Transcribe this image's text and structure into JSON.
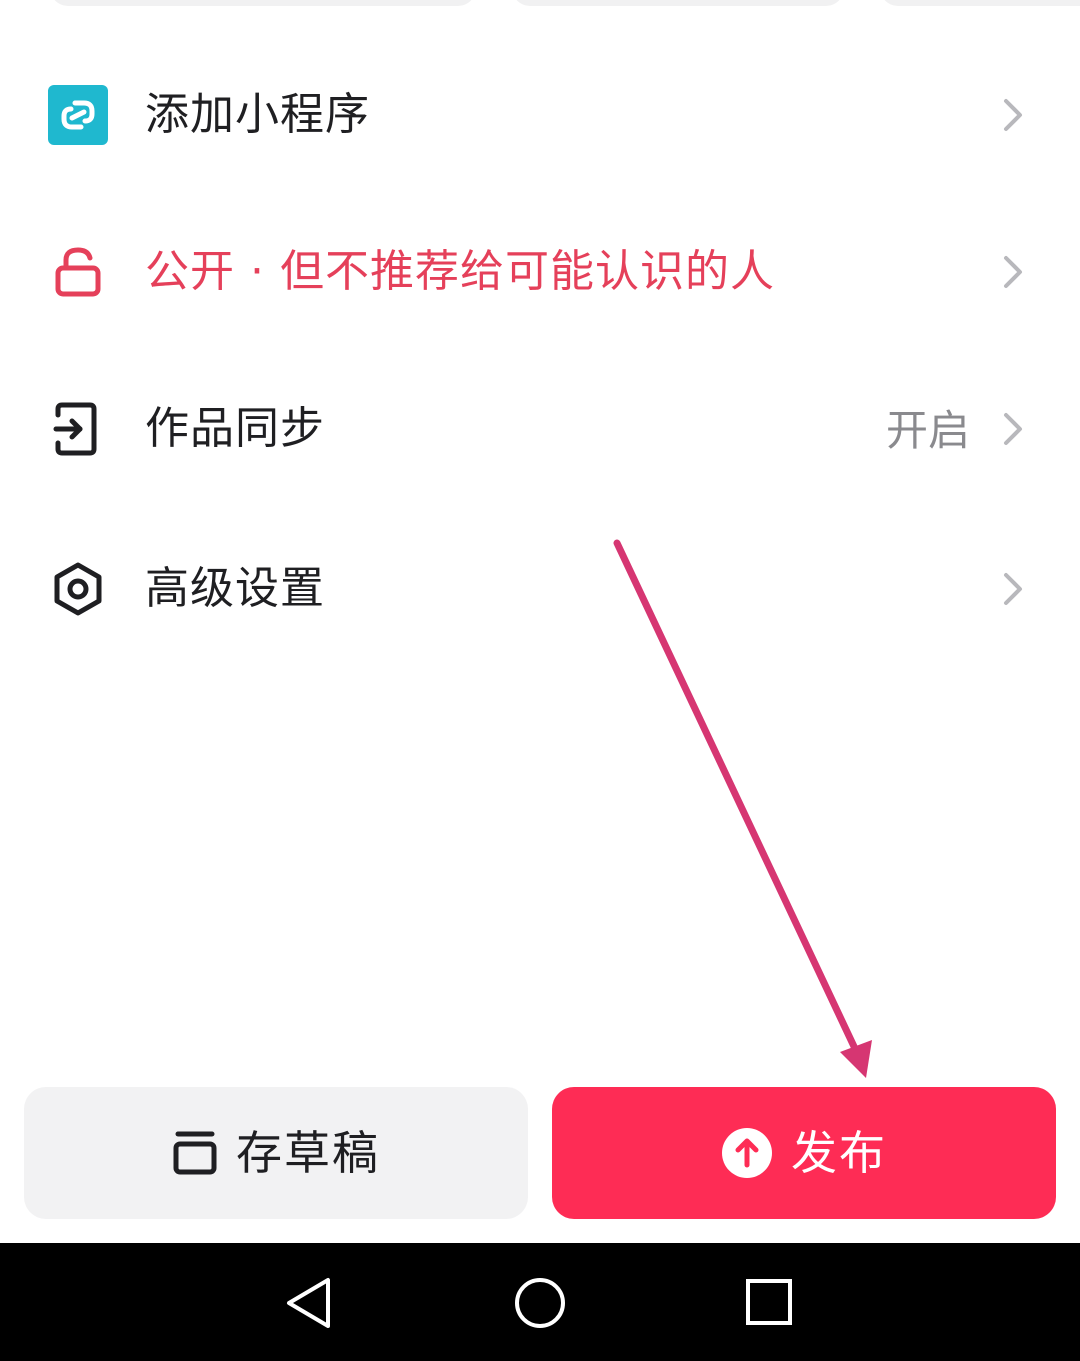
{
  "menu": {
    "items": [
      {
        "label": "添加小程序",
        "icon": "mini-program-icon",
        "value": ""
      },
      {
        "label": "公开 · 但不推荐给可能认识的人",
        "icon": "unlock-icon",
        "value": ""
      },
      {
        "label": "作品同步",
        "icon": "sync-icon",
        "value": "开启"
      },
      {
        "label": "高级设置",
        "icon": "settings-hexagon-icon",
        "value": ""
      }
    ]
  },
  "actions": {
    "draft_label": "存草稿",
    "publish_label": "发布"
  },
  "navbar": {
    "buttons": [
      "back-icon",
      "home-icon",
      "recents-icon"
    ]
  },
  "colors": {
    "accent_red": "#fe2c55",
    "privacy_red": "#e5405a",
    "mini_program_teal": "#1fb8cf",
    "annotation_pink": "#d63672"
  }
}
